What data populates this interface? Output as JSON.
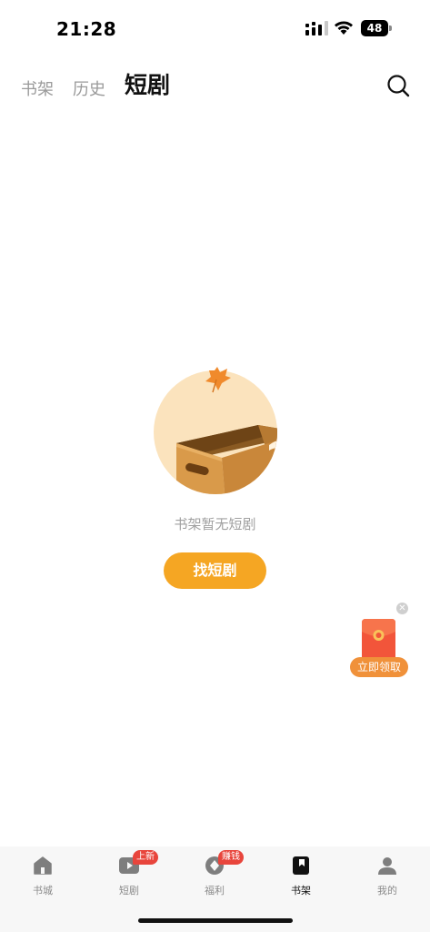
{
  "status_bar": {
    "time": "21:28",
    "battery": "48"
  },
  "header": {
    "tabs": [
      {
        "label": "书架"
      },
      {
        "label": "历史"
      },
      {
        "label": "短剧"
      }
    ],
    "active_tab": "短剧",
    "search_icon": "search-icon"
  },
  "empty_state": {
    "message": "书架暂无短剧",
    "button_label": "找短剧",
    "illustration": "empty-box-with-leaf"
  },
  "float_reward": {
    "label": "立即领取",
    "close_icon": "close-icon",
    "envelope_icon": "red-envelope-icon"
  },
  "bottom_nav": {
    "items": [
      {
        "label": "书城",
        "icon": "home-icon",
        "badge": ""
      },
      {
        "label": "短剧",
        "icon": "play-icon",
        "badge": "上新"
      },
      {
        "label": "福利",
        "icon": "coin-icon",
        "badge": "赚钱"
      },
      {
        "label": "书架",
        "icon": "bookmark-book-icon",
        "badge": ""
      },
      {
        "label": "我的",
        "icon": "user-icon",
        "badge": ""
      }
    ],
    "active": "书架"
  },
  "colors": {
    "accent": "#f5a623",
    "badge_red": "#e8453c",
    "reward_orange": "#f0913a"
  }
}
